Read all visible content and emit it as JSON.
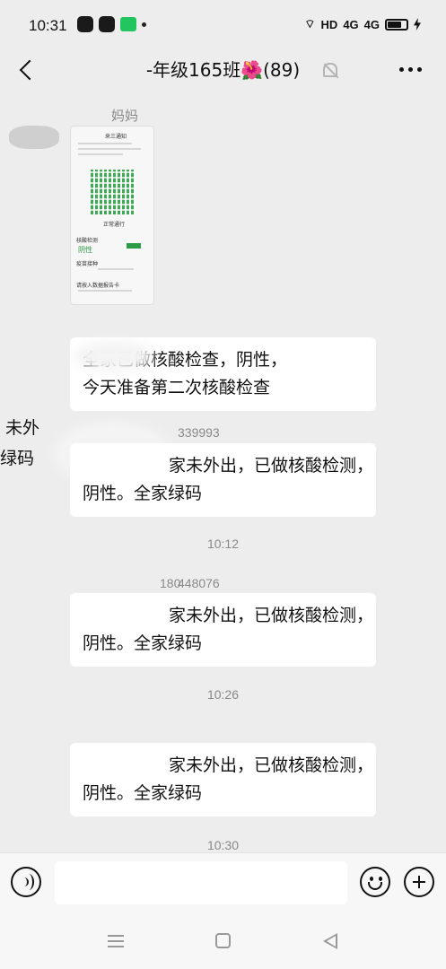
{
  "status_bar": {
    "time": "10:31",
    "network_label": "HD",
    "sim1_label": "4G",
    "sim2_label": "4G"
  },
  "header": {
    "title": "-年级165班",
    "title_emoji": "🌺",
    "member_count": "(89)"
  },
  "messages": {
    "sender_mom": "妈妈",
    "msg1_lines": [
      "全家已做核酸检查，阴性，",
      "今天准备第二次核酸检查"
    ],
    "sender_id_1": "339993",
    "left_fragment_1": "未外",
    "left_fragment_2": "绿码",
    "msg2_lines": [
      "家未外出，已做核酸检测，",
      "阴性。全家绿码"
    ],
    "time1": "10:12",
    "sender_id_2": "448076",
    "sender_id_2_prefix": "180",
    "msg3_lines": [
      "家未外出，已做核酸检测，",
      "阴性。全家绿码"
    ],
    "time2": "10:26",
    "msg4_lines": [
      "家未外出，已做核酸检测，",
      "阴性。全家绿码"
    ],
    "time3": "10:30"
  },
  "image_message": {
    "header": "来三通知",
    "code_status": "正常通行",
    "result_label": "核酸检测",
    "result_value": "阴性",
    "vaccine_label": "疫苗接种",
    "travel_label": "请按入数据报告卡"
  },
  "colors": {
    "background": "#ededed",
    "bubble": "#ffffff",
    "accent_green": "#2e9b47",
    "muted_text": "#8a8a8a"
  },
  "icons": {
    "back": "chevron-left-icon",
    "mute": "bell-off-icon",
    "more": "more-dots-icon",
    "voice": "voice-icon",
    "emoji": "emoji-icon",
    "plus": "plus-icon"
  }
}
